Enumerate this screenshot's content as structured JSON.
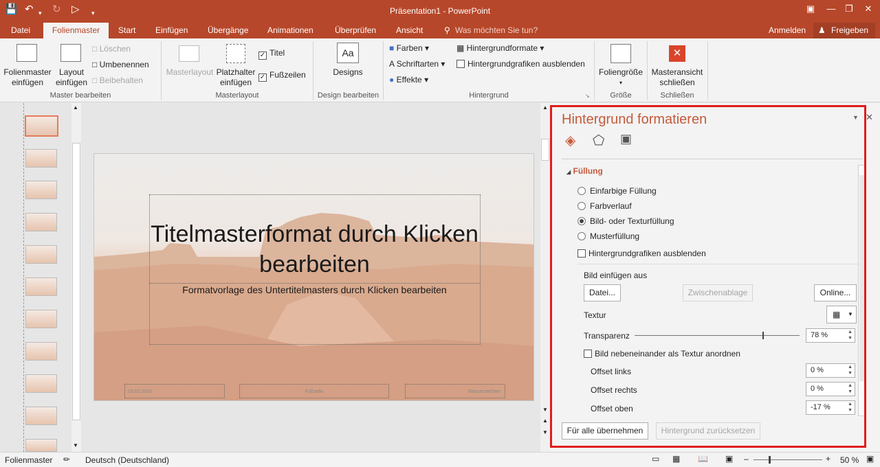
{
  "window": {
    "title": "Präsentation1 - PowerPoint"
  },
  "tabs": [
    "Datei",
    "Folienmaster",
    "Start",
    "Einfügen",
    "Übergänge",
    "Animationen",
    "Überprüfen",
    "Ansicht"
  ],
  "tell_me": "Was möchten Sie tun?",
  "account": {
    "signin": "Anmelden",
    "share": "Freigeben"
  },
  "ribbon": {
    "insert_master": "Folienmaster\neinfügen",
    "insert_layout": "Layout\neinfügen",
    "delete": "Löschen",
    "rename": "Umbenennen",
    "preserve": "Beibehalten",
    "group_master_edit": "Master bearbeiten",
    "master_layout": "Masterlayout",
    "placeholder_insert": "Platzhalter\neinfügen",
    "title_cb": "Titel",
    "footers_cb": "Fußzeilen",
    "group_master_layout": "Masterlayout",
    "designs": "Designs",
    "group_design": "Design bearbeiten",
    "colors": "Farben",
    "fonts": "Schriftarten",
    "effects": "Effekte",
    "bg_styles": "Hintergrundformate",
    "hide_bg": "Hintergrundgrafiken ausblenden",
    "group_bg": "Hintergrund",
    "slide_size": "Foliengröße",
    "group_size": "Größe",
    "close_master": "Masteransicht\nschließen",
    "group_close": "Schließen"
  },
  "slide": {
    "title": "Titelmasterformat durch Klicken bearbeiten",
    "subtitle": "Formatvorlage des Untertitelmasters durch Klicken bearbeiten",
    "date": "23.02.2016",
    "footer": "Fußzeile",
    "watermark": "Wasserzeichen"
  },
  "panel": {
    "title": "Hintergrund formatieren",
    "section": "Füllung",
    "fill_options": [
      "Einfarbige Füllung",
      "Farbverlauf",
      "Bild- oder Texturfüllung",
      "Musterfüllung"
    ],
    "selected_fill": 2,
    "hide_graphics": "Hintergrundgrafiken ausblenden",
    "insert_from": "Bild einfügen aus",
    "file_btn": "Datei...",
    "clipboard_btn": "Zwischenablage",
    "online_btn": "Online...",
    "texture": "Textur",
    "transparency": "Transparenz",
    "transparency_value": "78 %",
    "transparency_fraction": 0.78,
    "tile_cb": "Bild nebeneinander als Textur anordnen",
    "offset_left": "Offset links",
    "offset_left_value": "0 %",
    "offset_right": "Offset rechts",
    "offset_right_value": "0 %",
    "offset_top": "Offset oben",
    "offset_top_value": "-17 %",
    "apply_all": "Für alle übernehmen",
    "reset": "Hintergrund zurücksetzen"
  },
  "status": {
    "view": "Folienmaster",
    "language": "Deutsch (Deutschland)",
    "zoom": "50 %"
  },
  "colors": {
    "accent": "#b7472a",
    "highlight": "#e11b1b"
  }
}
